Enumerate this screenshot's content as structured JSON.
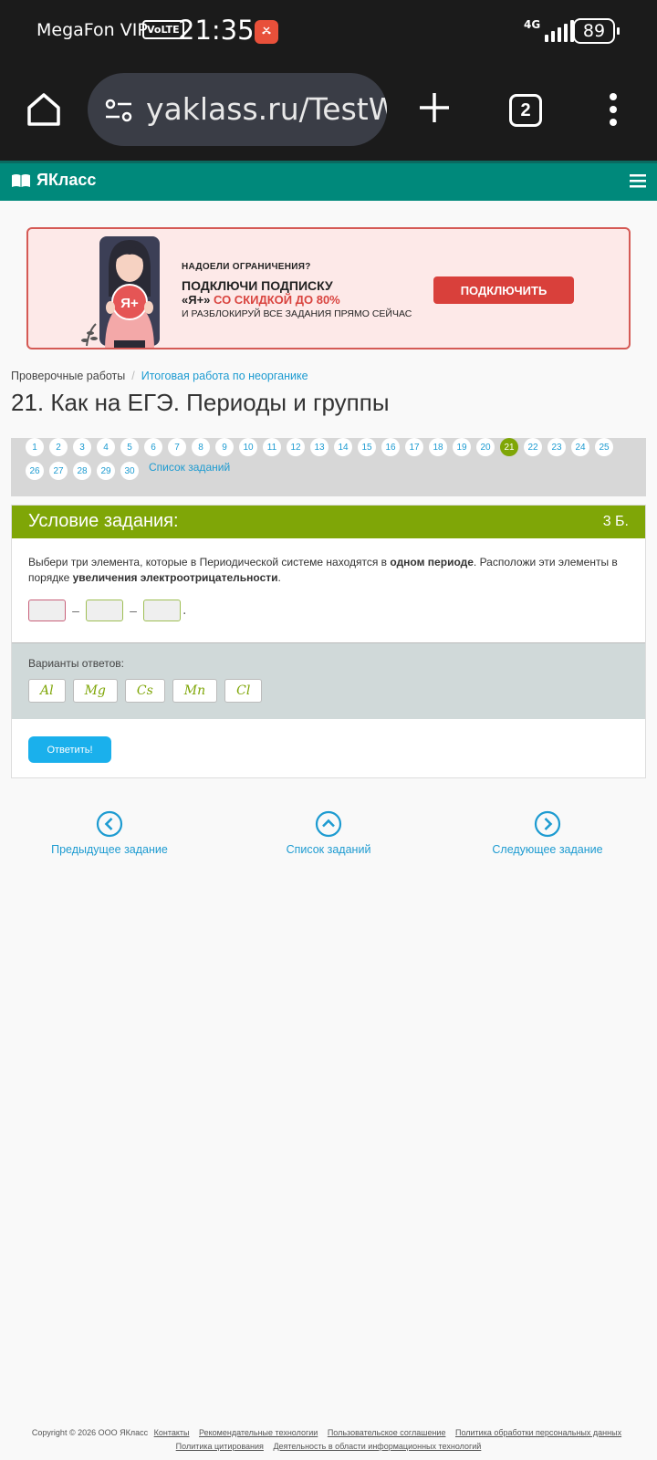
{
  "status_bar": {
    "carrier": "MegaFon VIP",
    "volte": "VoLTE",
    "time": "21:35",
    "network": "4G",
    "battery": "89"
  },
  "browser": {
    "url": "yaklass.ru/TestW",
    "tab_count": "2"
  },
  "site": {
    "logo": "ЯКласс"
  },
  "banner": {
    "line1": "НАДОЕЛИ ОГРАНИЧЕНИЯ?",
    "line2": "ПОДКЛЮЧИ ПОДПИСКУ",
    "line3_prefix": "«Я+»",
    "line3_highlight": " СО СКИДКОЙ ДО 80%",
    "line4": "И РАЗБЛОКИРУЙ ВСЕ ЗАДАНИЯ ПРЯМО СЕЙЧАС",
    "button": "ПОДКЛЮЧИТЬ",
    "badge": "Я+"
  },
  "breadcrumb": {
    "root": "Проверочные работы",
    "separator": "/",
    "current": "Итоговая работа по неорганике"
  },
  "page_title": "21. Как на ЕГЭ. Периоды и группы",
  "pagination": {
    "pages": [
      "1",
      "2",
      "3",
      "4",
      "5",
      "6",
      "7",
      "8",
      "9",
      "10",
      "11",
      "12",
      "13",
      "14",
      "15",
      "16",
      "17",
      "18",
      "19",
      "20",
      "21",
      "22",
      "23",
      "24",
      "25",
      "26",
      "27",
      "28",
      "29",
      "30"
    ],
    "active": "21",
    "list_link": "Список заданий"
  },
  "task": {
    "heading": "Условие задания:",
    "points": "3 Б.",
    "q_part1": "Выбери три элемента, которые в Периодической системе находятся в ",
    "q_bold1": "одном периоде",
    "q_part2": ". Расположи эти элементы в порядке ",
    "q_bold2": "увеличения электроотрицательности",
    "q_part3": ".",
    "dash": "–",
    "end_dot": ".",
    "variants_label": "Варианты ответов:",
    "variants": [
      "Al",
      "Mg",
      "Cs",
      "Mn",
      "Cl"
    ],
    "answer_button": "Ответить!"
  },
  "nav": {
    "prev": "Предыдущее задание",
    "list": "Список заданий",
    "next": "Следующее задание"
  },
  "footer": {
    "copyright": "Copyright © 2026 ООО ЯКласс",
    "links_row1": [
      "Контакты",
      "Рекомендательные технологии",
      "Пользовательское соглашение",
      "Политика обработки персональных данных"
    ],
    "links_row2": [
      "Политика цитирования",
      "Деятельность в области информационных технологий"
    ]
  },
  "colors": {
    "brand_teal": "#00897b",
    "accent_green": "#7fa607",
    "link_blue": "#1d9bd1",
    "banner_red": "#d9403b",
    "answer_blue": "#1ab0ec"
  }
}
